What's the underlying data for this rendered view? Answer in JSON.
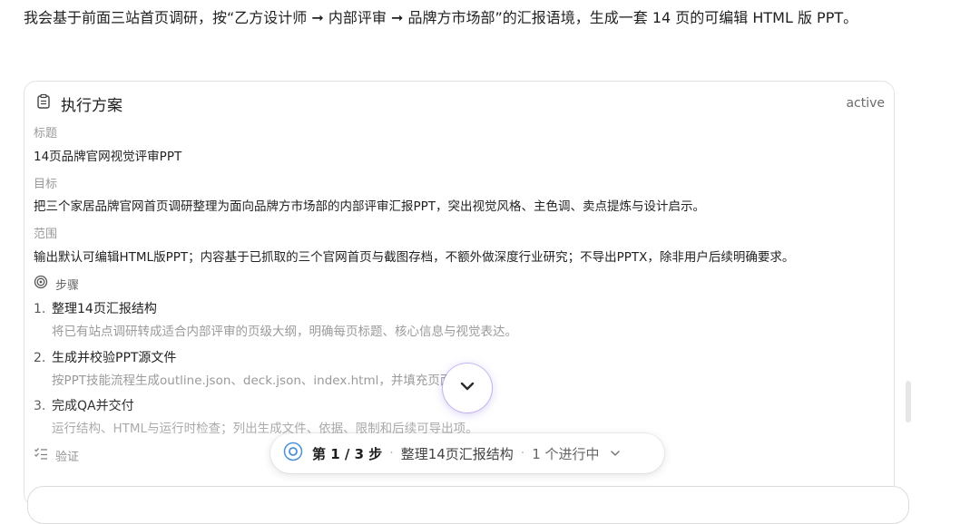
{
  "intro_text": "我会基于前面三站首页调研，按“乙方设计师 ➞ 内部评审 ➞ 品牌方市场部”的汇报语境，生成一套 14 页的可编辑 HTML 版 PPT。",
  "plan": {
    "title": "执行方案",
    "status": "active",
    "title_label": "标题",
    "title_value": "14页品牌官网视觉评审PPT",
    "goal_label": "目标",
    "goal_value": "把三个家居品牌官网首页调研整理为面向品牌方市场部的内部评审汇报PPT，突出视觉风格、主色调、卖点提炼与设计启示。",
    "scope_label": "范围",
    "scope_value": "输出默认可编辑HTML版PPT；内容基于已抓取的三个官网首页与截图存档，不额外做深度行业研究；不导出PPTX，除非用户后续明确要求。",
    "steps_label": "步骤",
    "steps": [
      {
        "num": "1.",
        "title": "整理14页汇报结构",
        "desc": "将已有站点调研转成适合内部评审的页级大纲，明确每页标题、核心信息与视觉表达。"
      },
      {
        "num": "2.",
        "title": "生成并校验PPT源文件",
        "desc": "按PPT技能流程生成outline.json、deck.json、index.html，并填充页面内容。"
      },
      {
        "num": "3.",
        "title": "完成QA并交付",
        "desc": "运行结构、HTML与运行时检查；列出生成文件、依据、限制和后续可导出项。"
      }
    ],
    "verify_label": "验证"
  },
  "progress": {
    "step_text": "第 1 / 3 步",
    "current_step": "整理14页汇报结构",
    "active_text": "1 个进行中"
  },
  "colors": {
    "accent": "#7b5cf0",
    "pill_ring": "#4a90d9"
  }
}
